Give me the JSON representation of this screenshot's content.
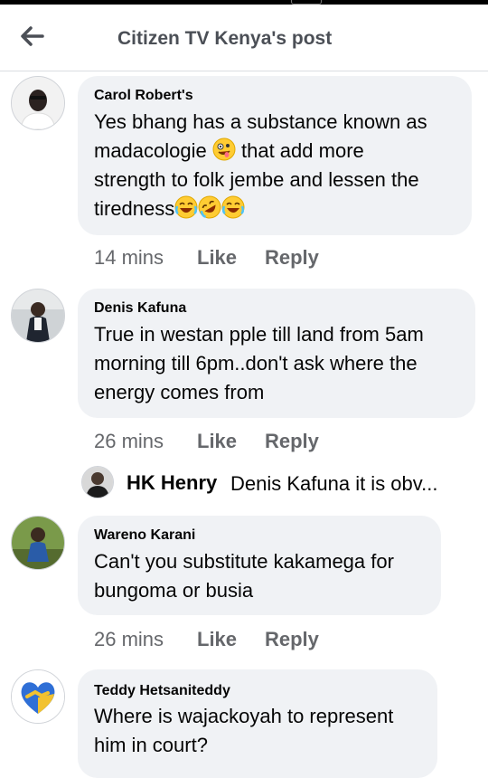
{
  "header": {
    "title": "Citizen TV Kenya's post",
    "back_icon": "back-arrow-icon"
  },
  "comments": [
    {
      "author": "Carol Robert's",
      "text_lines": [
        "Yes bhang has a substance known as",
        "madacologie",
        "that add more",
        "strength to folk jembe and lessen the",
        "tiredness"
      ],
      "time": "14 mins",
      "like": "Like",
      "reply": "Reply"
    },
    {
      "author": "Denis Kafuna",
      "text_lines": [
        "True in westan pple till land from 5am",
        "morning till 6pm..don't ask where the",
        "energy comes from"
      ],
      "time": "26 mins",
      "like": "Like",
      "reply": "Reply",
      "reply_preview": {
        "author": "HK Henry",
        "text": "Denis Kafuna it is obv..."
      }
    },
    {
      "author": "Wareno Karani",
      "text_lines": [
        "Can't you substitute kakamega for",
        "bungoma or busia"
      ],
      "time": "26 mins",
      "like": "Like",
      "reply": "Reply"
    },
    {
      "author": "Teddy Hetsaniteddy",
      "text_lines": [
        "Where is wajackoyah to represent",
        "him in court?"
      ]
    }
  ]
}
